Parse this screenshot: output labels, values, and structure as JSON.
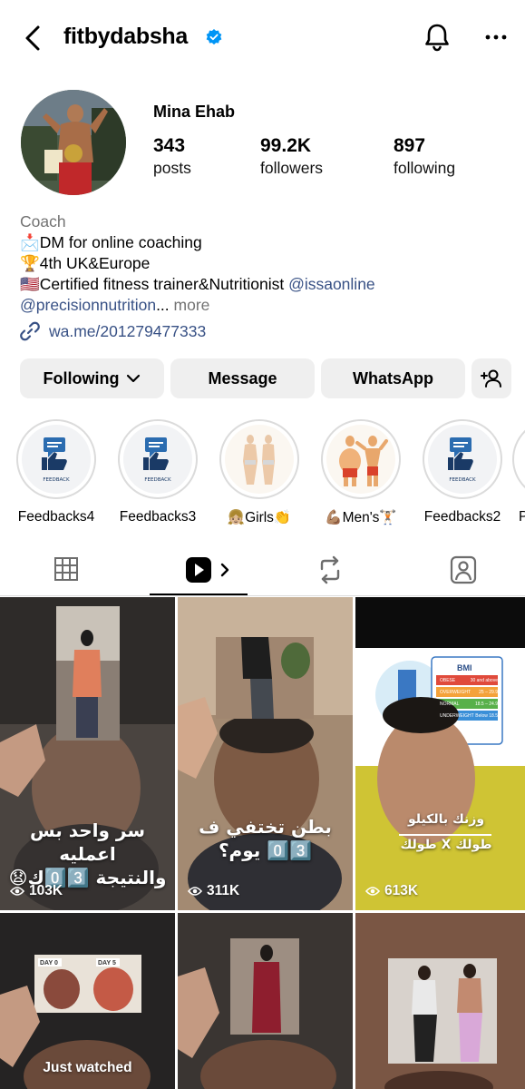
{
  "header": {
    "username": "fitbydabsha"
  },
  "profile": {
    "display_name": "Mina Ehab",
    "stats": [
      {
        "value": "343",
        "label": "posts"
      },
      {
        "value": "99.2K",
        "label": "followers"
      },
      {
        "value": "897",
        "label": "following"
      }
    ],
    "category": "Coach",
    "bio": {
      "line1": "📩DM for online coaching",
      "line2": "🏆4th UK&Europe",
      "line3_text": "🇺🇸Certified fitness trainer&Nutritionist ",
      "line3_mention": "@issaonline",
      "line4_mention": "@precisionnutrition",
      "line4_ellipsis": "... ",
      "line4_more": "more"
    },
    "link": "wa.me/201279477333"
  },
  "buttons": {
    "following": "Following",
    "message": "Message",
    "whatsapp": "WhatsApp"
  },
  "highlights": [
    {
      "label": "Feedbacks4"
    },
    {
      "label": "Feedbacks3"
    },
    {
      "label": "👧🏼Girls👏"
    },
    {
      "label": "💪🏽Men's🏋🏻"
    },
    {
      "label": "Feedbacks2"
    },
    {
      "label": "P"
    }
  ],
  "highlight_badge": "FEEDBACK",
  "tabs": [
    "grid-tab",
    "reels-tab",
    "reposts-tab",
    "tagged-tab"
  ],
  "grid": [
    {
      "caption_1": "سر واحد بس اعمليه",
      "caption_2": "والنتيجة 0️⃣3️⃣ك😧",
      "views": "103K"
    },
    {
      "caption_1": "بطن تختفي ف",
      "caption_2": "0️⃣3️⃣ يوم؟",
      "views": "311K"
    },
    {
      "caption_1": "وزنك بالكيلو",
      "caption_2": "طولك X طولك",
      "views": "613K",
      "bmi_title": "BMI",
      "bmi_rows": [
        "OBESE",
        "OVERWEIGHT",
        "NORMAL",
        "UNDERWEIGHT"
      ],
      "bmi_values": [
        "30 and above",
        "25 – 29.9",
        "18.5 – 24.9",
        "Below 18.5"
      ]
    },
    {
      "watched": "Just watched",
      "day0": "DAY 0",
      "day5": "DAY 5"
    },
    {},
    {}
  ]
}
